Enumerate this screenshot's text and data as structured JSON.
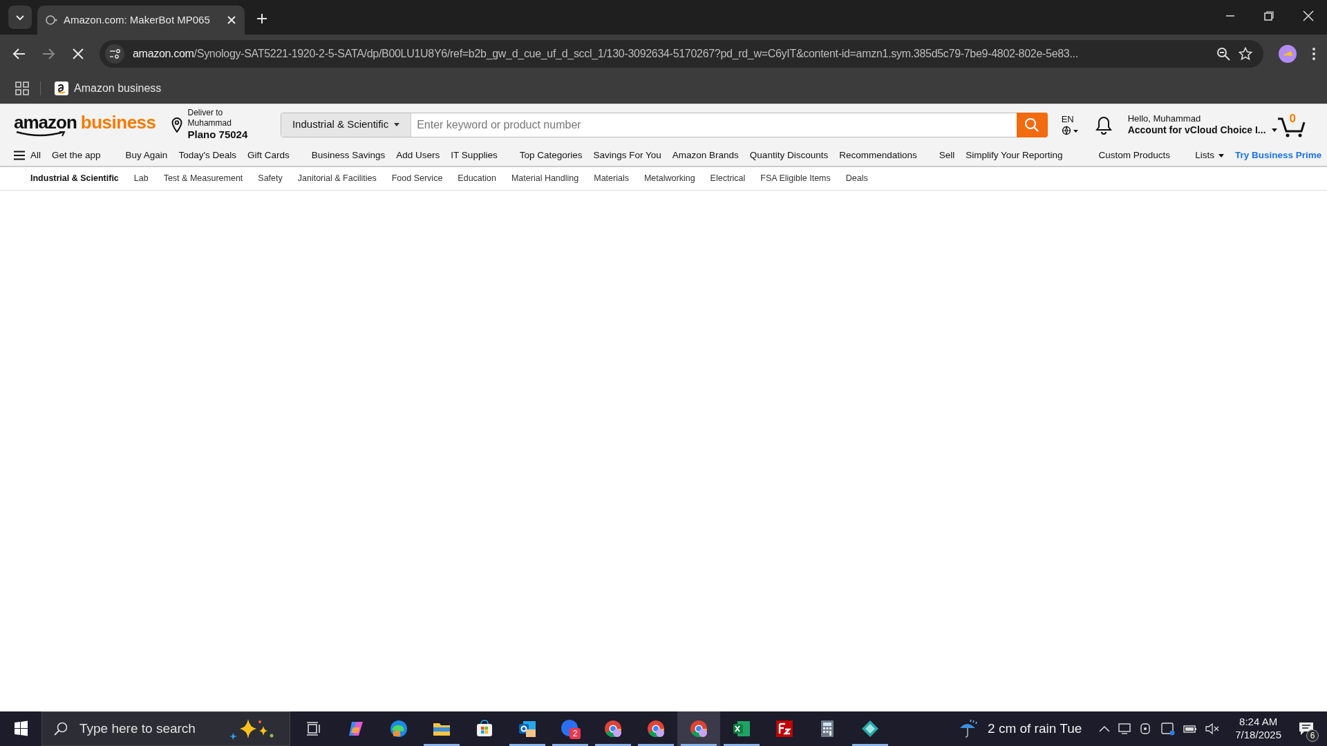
{
  "browser": {
    "tab": {
      "title": "Amazon.com: MakerBot MP065",
      "selected": true
    },
    "url": {
      "host": "amazon.com",
      "path": "/Synology-SAT5221-1920-2-5-SATA/dp/B00LU1U8Y6/ref=b2b_gw_d_cue_uf_d_sccl_1/130-3092634-5170267?pd_rd_w=C6yIT&content-id=amzn1.sym.385d5c79-7be9-4802-802e-5e83..."
    },
    "loading": true,
    "bookmarks": [
      {
        "label": "Amazon business"
      }
    ]
  },
  "header": {
    "logo": {
      "word1": "amazon",
      "word2": "business"
    },
    "deliver": {
      "line1": "Deliver to Muhammad",
      "line2": "Plano 75024"
    },
    "search": {
      "category": "Industrial & Scientific",
      "placeholder": "Enter keyword or product number"
    },
    "language": "EN",
    "account": {
      "greeting": "Hello, Muhammad",
      "name": "Account for vCloud Choice I..."
    },
    "cart_count": "0"
  },
  "nav": {
    "all": "All",
    "items": [
      {
        "label": "Get the app",
        "kind": "link"
      },
      {
        "label": "Buy Again",
        "kind": "link"
      },
      {
        "label": "Today's Deals",
        "kind": "link"
      },
      {
        "label": "Gift Cards",
        "kind": "link"
      },
      {
        "label": "Business Savings",
        "kind": "link"
      },
      {
        "label": "Add Users",
        "kind": "link"
      },
      {
        "label": "IT Supplies",
        "kind": "link"
      },
      {
        "label": "Top Categories",
        "kind": "link"
      },
      {
        "label": "Savings For You",
        "kind": "link"
      },
      {
        "label": "Amazon Brands",
        "kind": "link"
      },
      {
        "label": "Quantity Discounts",
        "kind": "link"
      },
      {
        "label": "Recommendations",
        "kind": "link"
      },
      {
        "label": "Sell",
        "kind": "link"
      },
      {
        "label": "Simplify Your Reporting",
        "kind": "link"
      },
      {
        "label": "Custom Products",
        "kind": "link"
      },
      {
        "label": "Lists",
        "kind": "menu"
      },
      {
        "label": "Try Business Prime",
        "kind": "prime"
      }
    ]
  },
  "subnav": [
    {
      "label": "Industrial & Scientific",
      "selected": true
    },
    {
      "label": "Lab",
      "selected": false
    },
    {
      "label": "Test & Measurement",
      "selected": false
    },
    {
      "label": "Safety",
      "selected": false
    },
    {
      "label": "Janitorial & Facilities",
      "selected": false
    },
    {
      "label": "Food Service",
      "selected": false
    },
    {
      "label": "Education",
      "selected": false
    },
    {
      "label": "Material Handling",
      "selected": false
    },
    {
      "label": "Materials",
      "selected": false
    },
    {
      "label": "Metalworking",
      "selected": false
    },
    {
      "label": "Electrical",
      "selected": false
    },
    {
      "label": "FSA Eligible Items",
      "selected": false
    },
    {
      "label": "Deals",
      "selected": false
    }
  ],
  "taskbar": {
    "search_placeholder": "Type here to search",
    "apps": [
      {
        "kind": "taskview",
        "running": false,
        "active": false
      },
      {
        "kind": "copilot",
        "running": false,
        "active": false
      },
      {
        "kind": "edge",
        "running": false,
        "active": false
      },
      {
        "kind": "explorer",
        "running": true,
        "active": false
      },
      {
        "kind": "store",
        "running": false,
        "active": false
      },
      {
        "kind": "outlook",
        "running": true,
        "active": false
      },
      {
        "kind": "zoom",
        "running": true,
        "active": false,
        "badge": "2"
      },
      {
        "kind": "chrome",
        "running": true,
        "active": false
      },
      {
        "kind": "chrome",
        "running": true,
        "active": false
      },
      {
        "kind": "chrome",
        "running": true,
        "active": true
      },
      {
        "kind": "excel",
        "running": true,
        "active": false
      },
      {
        "kind": "filezilla",
        "running": false,
        "active": false
      },
      {
        "kind": "calculator",
        "running": false,
        "active": false
      },
      {
        "kind": "gem",
        "running": true,
        "active": false
      }
    ],
    "weather": "2 cm of rain Tue",
    "time": "8:24 AM",
    "date": "7/18/2025",
    "notifications": "6"
  }
}
